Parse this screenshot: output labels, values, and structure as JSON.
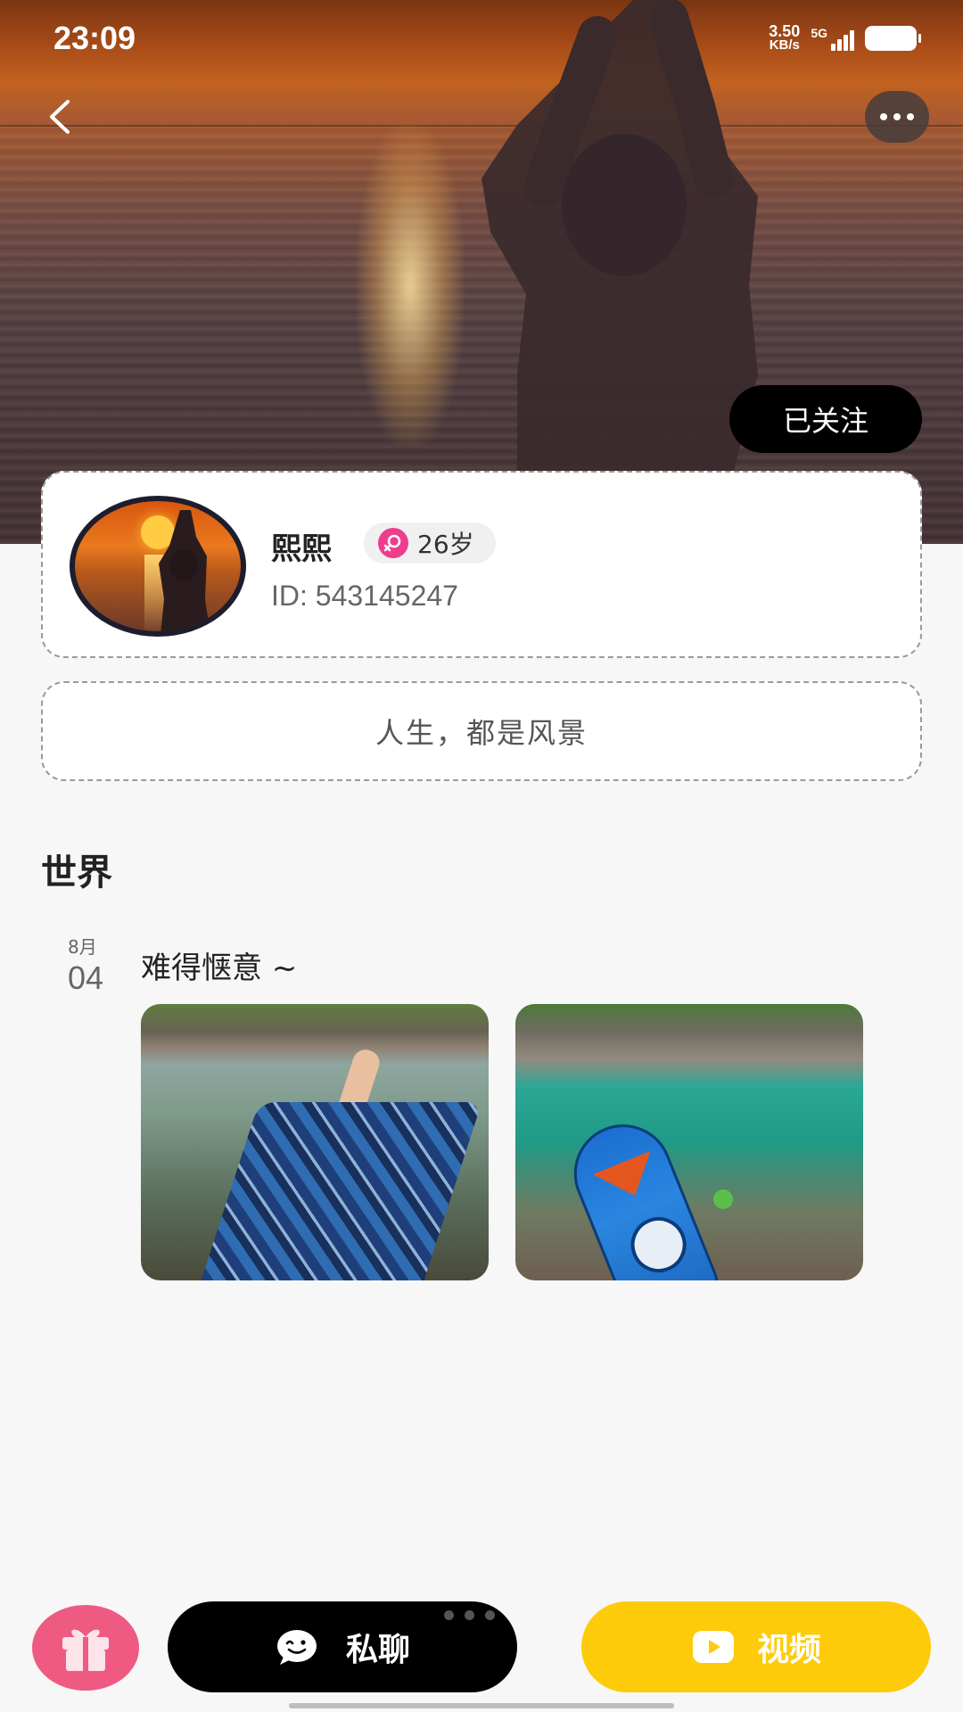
{
  "status_bar": {
    "time": "23:09",
    "net_speed_value": "3.50",
    "net_speed_unit": "KB/s",
    "network": "5G"
  },
  "header": {
    "back_icon": "chevron-left-icon",
    "more_icon": "ellipsis-icon",
    "follow_label": "已关注"
  },
  "profile": {
    "nickname": "熙熙",
    "gender": "female",
    "age": "26岁",
    "id": "ID: 543145247",
    "signature": "人生，都是风景"
  },
  "section": {
    "title": "世界"
  },
  "post": {
    "month": "8月",
    "day": "04",
    "text": "难得惬意 ~",
    "photos": [
      "feet-in-clear-stream",
      "paddle-board-on-riverbank"
    ]
  },
  "actions": {
    "gift_icon": "gift-icon",
    "chat_label": "私聊",
    "chat_icon": "chat-bubble-icon",
    "video_label": "视频",
    "video_icon": "video-play-icon"
  },
  "colors": {
    "follow_button": "#000000",
    "chat_button": "#000000",
    "video_button": "#fecb0a",
    "gift_button": "#ef5a83",
    "gender_badge": "#ee3d8d"
  }
}
